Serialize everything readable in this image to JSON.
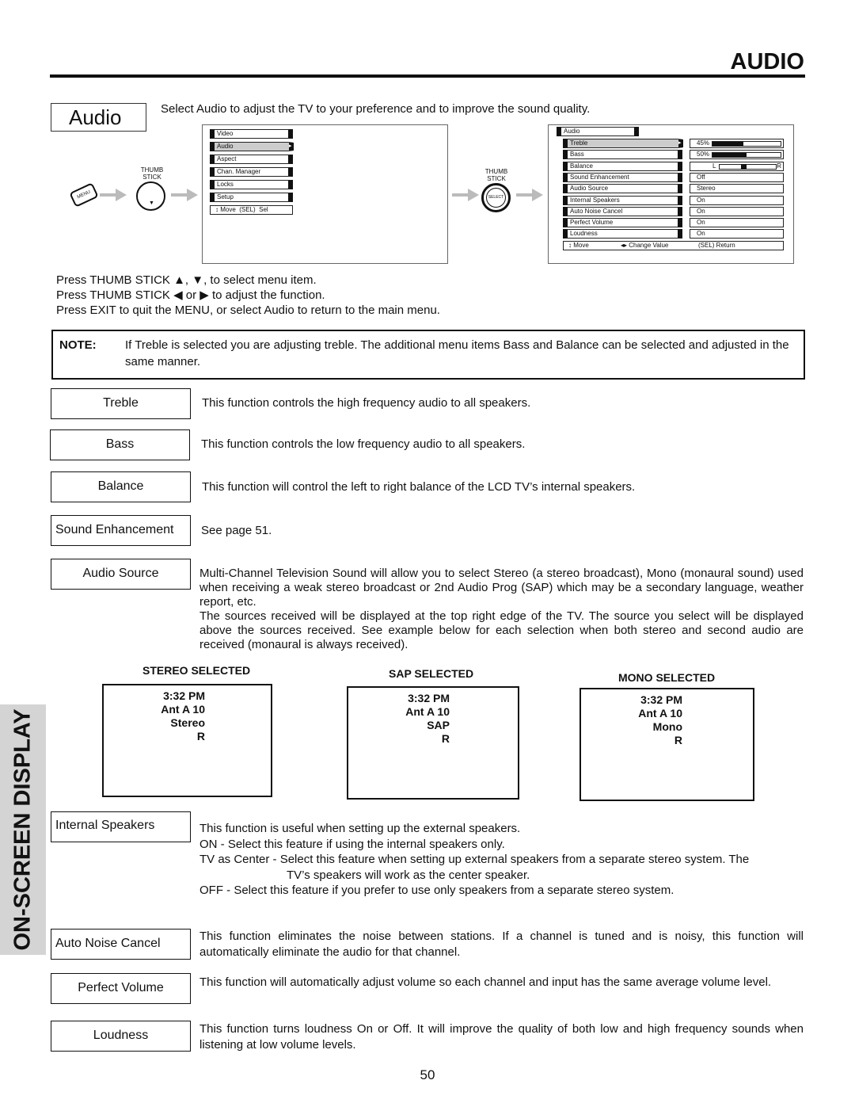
{
  "header": {
    "section": "AUDIO"
  },
  "title_box": "Audio",
  "intro": "Select Audio to adjust the TV to your preference and to improve the sound quality.",
  "diagram": {
    "menu_button": "MENU",
    "thumb_stick": "THUMB STICK",
    "select_label": "SELECT",
    "main_menu": {
      "items": [
        "Video",
        "Audio",
        "Aspect",
        "Chan. Manager",
        "Locks",
        "Setup"
      ],
      "selected": "Audio",
      "footer": "↕ Move  (SEL)  Sel"
    },
    "audio_menu": {
      "title": "Audio",
      "items": [
        {
          "label": "Treble",
          "value": "45%",
          "level": 45
        },
        {
          "label": "Bass",
          "value": "50%",
          "level": 50
        },
        {
          "label": "Balance",
          "value_left": "L",
          "value_right": "R",
          "level": 50
        },
        {
          "label": "Sound Enhancement",
          "value": "Off"
        },
        {
          "label": "Audio Source",
          "value": "Stereo"
        },
        {
          "label": "Internal Speakers",
          "value": "On"
        },
        {
          "label": "Auto Noise Cancel",
          "value": "On"
        },
        {
          "label": "Perfect Volume",
          "value": "On"
        },
        {
          "label": "Loudness",
          "value": "On"
        }
      ],
      "selected": "Treble",
      "footer": {
        "move": "↕ Move",
        "change": "◂▸ Change Value",
        "ret": "(SEL) Return"
      }
    }
  },
  "instructions": [
    "Press THUMB STICK ▲, ▼, to select menu item.",
    "Press THUMB STICK  ◀ or ▶ to adjust the function.",
    "Press EXIT to quit the MENU, or select Audio to return to the main menu."
  ],
  "note": {
    "label": "NOTE:",
    "text": "If Treble is selected you are adjusting treble.  The additional menu items Bass and Balance can be selected and adjusted in the same manner."
  },
  "features": [
    {
      "label": "Treble",
      "desc": "This function controls the high frequency audio to all speakers."
    },
    {
      "label": "Bass",
      "desc": "This function controls the low frequency audio to all speakers."
    },
    {
      "label": "Balance",
      "desc": "This function will control the left to right balance of the LCD TV’s internal speakers."
    },
    {
      "label": "Sound Enhancement",
      "desc": "See page 51."
    },
    {
      "label": "Audio Source",
      "desc": "Multi-Channel Television Sound will allow you to select Stereo (a stereo broadcast), Mono (monaural sound) used when receiving a weak stereo broadcast or 2nd Audio Prog (SAP) which may be a secondary language, weather report, etc.",
      "desc2": "The sources received will be displayed at the top right edge of the TV.  The source you select will be displayed above the sources received.  See example below for each selection when both stereo and second audio are received (monaural is always received)."
    },
    {
      "label": "Internal Speakers",
      "desc": "This function is useful when setting up the external speakers.",
      "lines": [
        "ON - Select this feature if using the internal speakers only.",
        "TV as Center - Select this feature when setting up external speakers from a separate stereo system.  The",
        "TV’s speakers will work as the center speaker.",
        "OFF - Select this feature if you prefer to use only speakers from a separate stereo system."
      ]
    },
    {
      "label": "Auto Noise Cancel",
      "desc": "This function eliminates the noise between stations. If a channel is tuned and is noisy, this function will automatically eliminate the audio for that channel."
    },
    {
      "label": "Perfect Volume",
      "desc": "This function will automatically adjust volume so each channel  and input has the same average volume level."
    },
    {
      "label": "Loudness",
      "desc": "This function turns loudness On or Off.  It will improve the quality of both low and high frequency sounds when listening at low volume levels."
    }
  ],
  "examples": [
    {
      "title": "STEREO SELECTED",
      "lines": [
        "3:32 PM",
        "Ant A 10",
        "Stereo",
        "R"
      ]
    },
    {
      "title": "SAP SELECTED",
      "lines": [
        "3:32 PM",
        "Ant A 10",
        "SAP",
        "R"
      ]
    },
    {
      "title": "MONO SELECTED",
      "lines": [
        "3:32 PM",
        "Ant A 10",
        "Mono",
        "R"
      ]
    }
  ],
  "side_tab": "ON-SCREEN DISPLAY",
  "page_number": "50"
}
